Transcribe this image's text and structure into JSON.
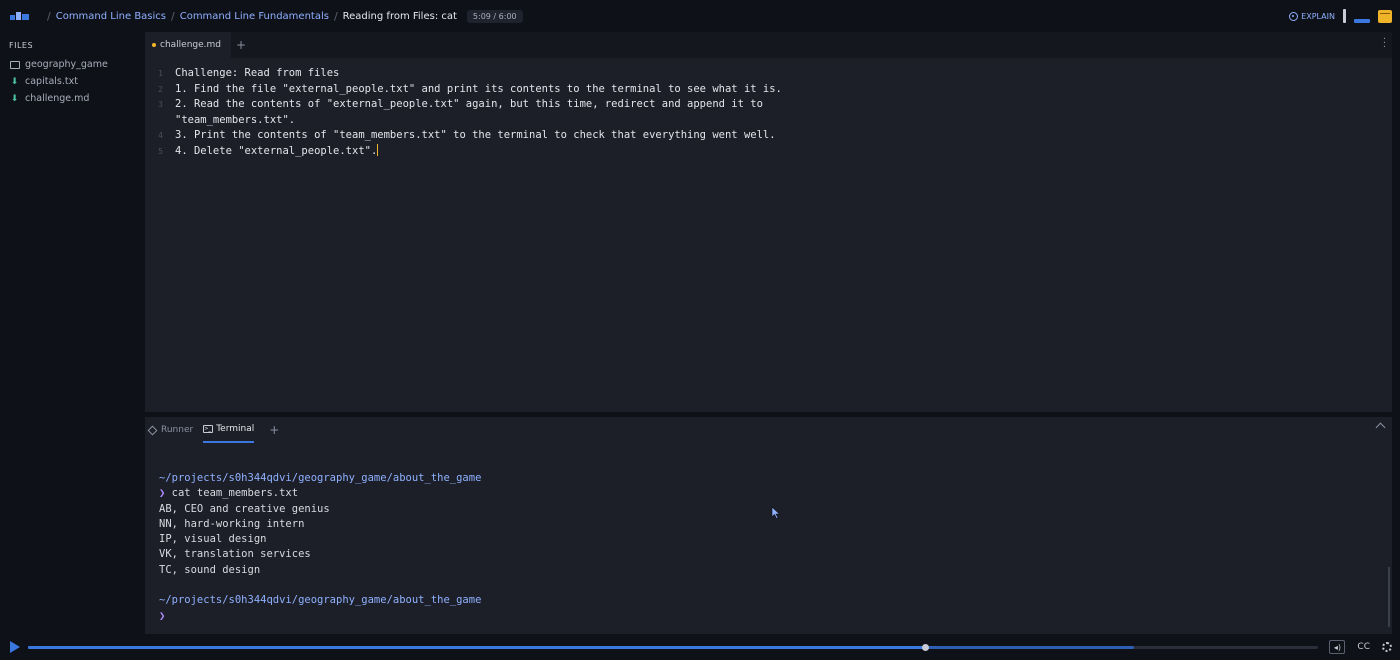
{
  "breadcrumbs": {
    "course": "Command Line Basics",
    "module": "Command Line Fundamentals",
    "lesson": "Reading from Files: cat",
    "timer": "5:09 / 6:00"
  },
  "topbar": {
    "explain_label": "EXPLAIN"
  },
  "sidebar": {
    "title": "FILES",
    "items": [
      {
        "label": "geography_game",
        "icon": "folder-icon"
      },
      {
        "label": "capitals.txt",
        "icon": "file-icon"
      },
      {
        "label": "challenge.md",
        "icon": "file-icon"
      }
    ]
  },
  "editor": {
    "tab_label": "challenge.md",
    "lines": [
      {
        "num": "1",
        "text": "Challenge: Read from files"
      },
      {
        "num": "2",
        "text": "1. Find the file \"external_people.txt\" and print its contents to the terminal to see what it is."
      },
      {
        "num": "3",
        "text": "2. Read the contents of \"external_people.txt\" again, but this time, redirect and append it to"
      },
      {
        "num": "",
        "text": "\"team_members.txt\"."
      },
      {
        "num": "4",
        "text": "3. Print the contents of \"team_members.txt\" to the terminal to check that everything went well."
      },
      {
        "num": "5",
        "text": "4. Delete \"external_people.txt\"."
      }
    ]
  },
  "terminal_panel": {
    "tabs": [
      "Runner",
      "Terminal"
    ],
    "path1": "~/projects/s0h344qdvi/geography_game/about_the_game",
    "prompt": "❯",
    "command": " cat team_members.txt",
    "output": [
      "AB, CEO and creative genius",
      "NN, hard-working intern",
      "IP, visual design",
      "VK, translation services",
      "TC, sound design"
    ],
    "path2": "~/projects/s0h344qdvi/geography_game/about_the_game"
  },
  "playbar": {
    "progress": 0.695,
    "buffered": 0.857,
    "cc_label": "CC"
  },
  "colors": {
    "accent": "#3a78e0",
    "link": "#8fb0ff",
    "prompt": "#b08cff",
    "unsaved_dot": "#f0b429"
  }
}
